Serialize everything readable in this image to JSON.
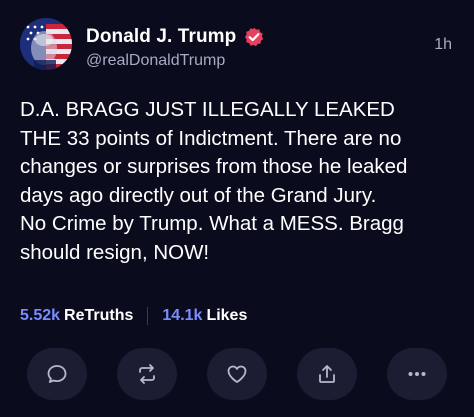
{
  "post": {
    "author": {
      "display_name": "Donald J. Trump",
      "handle": "@realDonaldTrump",
      "verified": true,
      "avatar_icon": "flag-portrait-avatar"
    },
    "time": "1h",
    "text": "D.A. BRAGG JUST ILLEGALLY LEAKED\nTHE 33 points of Indictment. There are no\nchanges or surprises from those he leaked\ndays ago directly out of the Grand Jury.\nNo Crime by Trump. What a MESS. Bragg\nshould resign, NOW!",
    "stats": {
      "retruths_count": "5.52k",
      "retruths_label": "ReTruths",
      "likes_count": "14.1k",
      "likes_label": "Likes"
    },
    "actions": [
      {
        "icon": "reply-icon"
      },
      {
        "icon": "retruth-icon"
      },
      {
        "icon": "like-icon"
      },
      {
        "icon": "share-icon"
      },
      {
        "icon": "more-icon"
      }
    ]
  },
  "colors": {
    "background": "#0b0b1e",
    "accent": "#7b8cff",
    "verified_badge": "#e5405e",
    "muted_text": "#a9a9c3",
    "button_bg": "#1c1c33"
  }
}
